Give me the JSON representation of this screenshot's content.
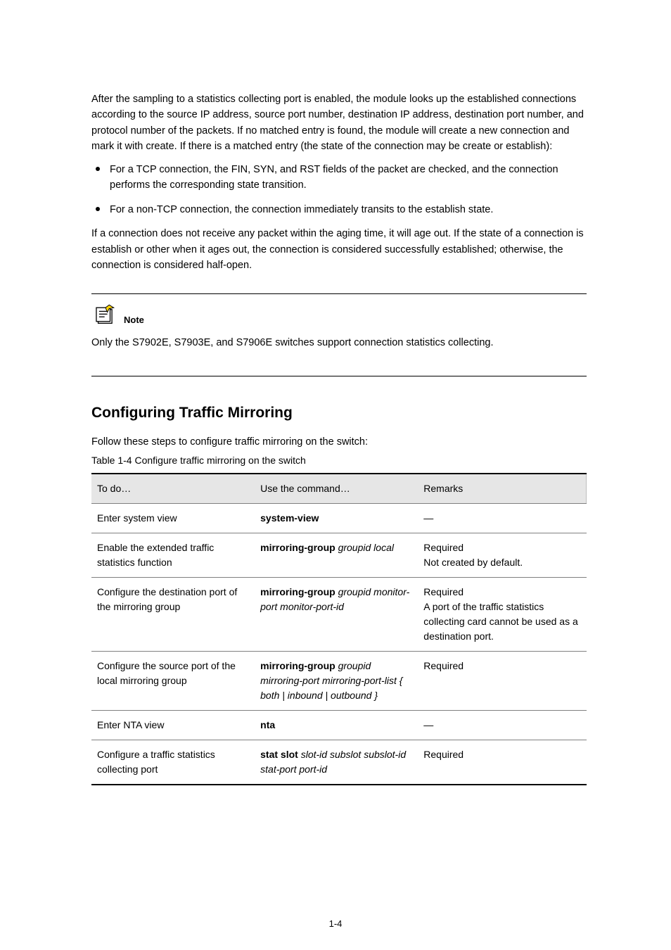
{
  "intro": {
    "p1": "After the sampling to a statistics collecting port is enabled, the module looks up the established connections according to the source IP address, source port number, destination IP address, destination port number, and protocol number of the packets. If no matched entry is found, the module will create a new connection and mark it with create. If there is a matched entry (the state of the connection may be create or establish):",
    "b1": "For a TCP connection, the FIN, SYN, and RST fields of the packet are checked, and the connection performs the corresponding state transition.",
    "b2": "For a non-TCP connection, the connection immediately transits to the establish state.",
    "p2": "If a connection does not receive any packet within the aging time, it will age out. If the state of a connection is establish or other when it ages out, the connection is considered successfully established; otherwise, the connection is considered half-open."
  },
  "note": {
    "label": "Note",
    "text": "Only the S7902E, S7903E, and S7906E switches support connection statistics collecting."
  },
  "section": {
    "heading": "Configuring Traffic Mirroring",
    "lead": "Follow these steps to configure traffic mirroring on the switch:",
    "table_caption": "Table 1-4 Configure traffic mirroring on the switch"
  },
  "table": {
    "headers": {
      "a": "To do…",
      "b": "Use the command…",
      "c": "Remarks"
    },
    "rows": [
      {
        "a": "Enter system view",
        "b_bold": "system-view",
        "b_rest": "",
        "c": "—"
      },
      {
        "a": "Enable the extended traffic statistics function",
        "b_bold": "mirroring-group",
        "b_rest": " groupid local",
        "c": "Required\nNot created by default."
      },
      {
        "a": "Configure the destination port of the mirroring group",
        "b_bold": "mirroring-group",
        "b_rest": " groupid monitor-port monitor-port-id",
        "c": "Required\nA port of the traffic statistics collecting card cannot be used as a destination port."
      },
      {
        "a": "Configure the source port of the local mirroring group",
        "b_bold": "mirroring-group",
        "b_rest": " groupid mirroring-port mirroring-port-list { both | inbound | outbound }",
        "c": "Required"
      },
      {
        "a": "Enter NTA view",
        "b_bold": "nta",
        "b_rest": "",
        "c": "—"
      },
      {
        "a": "Configure a traffic statistics collecting port",
        "b_bold": "stat slot",
        "b_rest": " slot-id subslot subslot-id stat-port port-id",
        "c": "Required"
      }
    ]
  },
  "page_number": "1-4"
}
